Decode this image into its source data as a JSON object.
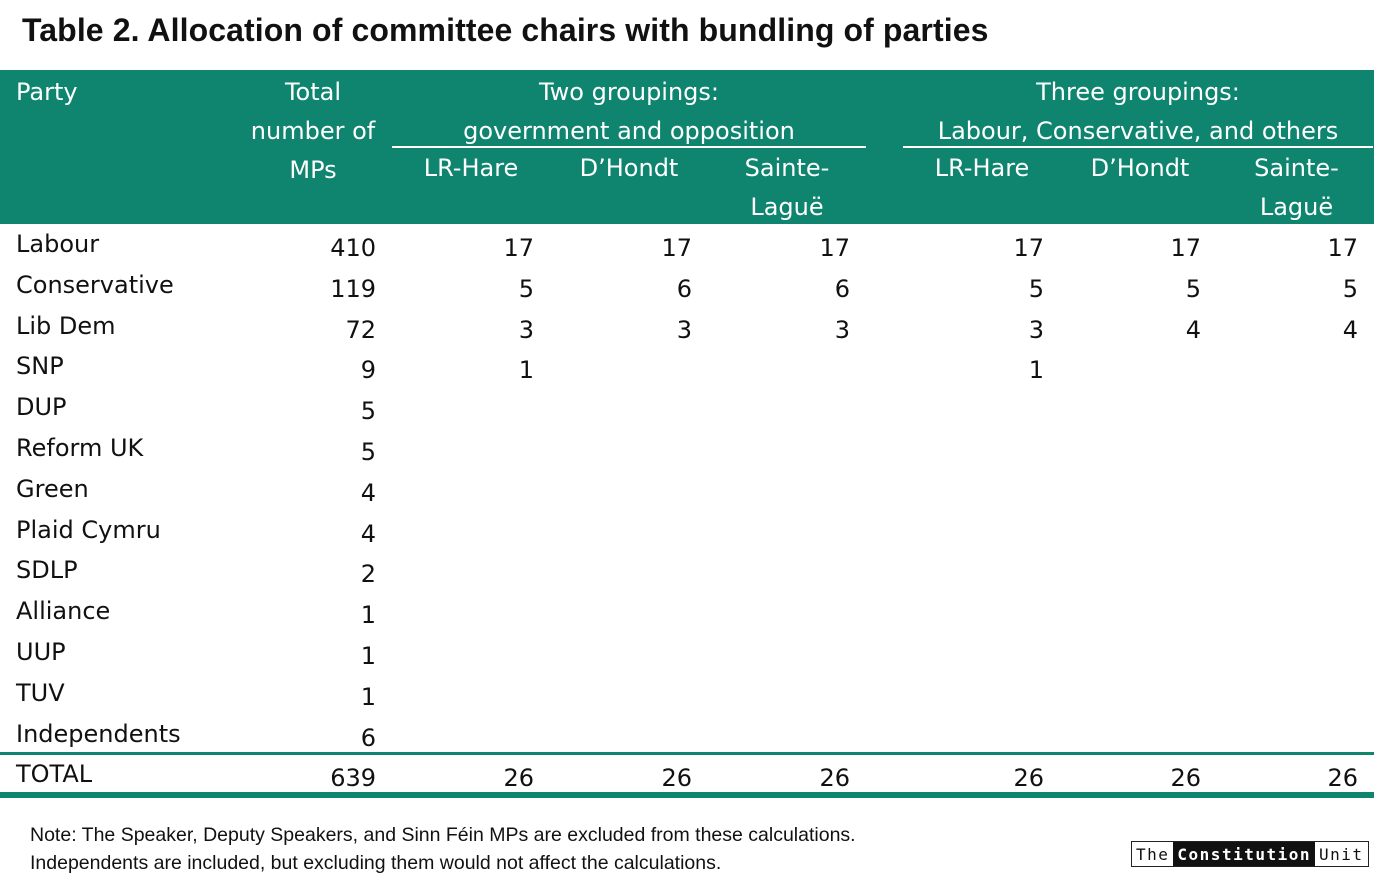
{
  "title": "Table 2. Allocation of committee chairs with bundling of parties",
  "header": {
    "party": "Party",
    "total_line1": "Total",
    "total_line2": "number of",
    "total_line3": "MPs",
    "group2_line1": "Two groupings:",
    "group2_line2": "government and opposition",
    "group3_line1": "Three groupings:",
    "group3_line2": "Labour, Conservative, and others",
    "lr_hare": "LR-Hare",
    "dhondt": "D’Hondt",
    "sl_line1": "Sainte-",
    "sl_line2": "Laguë"
  },
  "rows": [
    {
      "party": "Labour",
      "total": "410",
      "two_lr": "17",
      "two_dh": "17",
      "two_sl": "17",
      "three_lr": "17",
      "three_dh": "17",
      "three_sl": "17"
    },
    {
      "party": "Conservative",
      "total": "119",
      "two_lr": "5",
      "two_dh": "6",
      "two_sl": "6",
      "three_lr": "5",
      "three_dh": "5",
      "three_sl": "5"
    },
    {
      "party": "Lib Dem",
      "total": "72",
      "two_lr": "3",
      "two_dh": "3",
      "two_sl": "3",
      "three_lr": "3",
      "three_dh": "4",
      "three_sl": "4"
    },
    {
      "party": "SNP",
      "total": "9",
      "two_lr": "1",
      "two_dh": "",
      "two_sl": "",
      "three_lr": "1",
      "three_dh": "",
      "three_sl": ""
    },
    {
      "party": "DUP",
      "total": "5",
      "two_lr": "",
      "two_dh": "",
      "two_sl": "",
      "three_lr": "",
      "three_dh": "",
      "three_sl": ""
    },
    {
      "party": "Reform UK",
      "total": "5",
      "two_lr": "",
      "two_dh": "",
      "two_sl": "",
      "three_lr": "",
      "three_dh": "",
      "three_sl": ""
    },
    {
      "party": "Green",
      "total": "4",
      "two_lr": "",
      "two_dh": "",
      "two_sl": "",
      "three_lr": "",
      "three_dh": "",
      "three_sl": ""
    },
    {
      "party": "Plaid Cymru",
      "total": "4",
      "two_lr": "",
      "two_dh": "",
      "two_sl": "",
      "three_lr": "",
      "three_dh": "",
      "three_sl": ""
    },
    {
      "party": "SDLP",
      "total": "2",
      "two_lr": "",
      "two_dh": "",
      "two_sl": "",
      "three_lr": "",
      "three_dh": "",
      "three_sl": ""
    },
    {
      "party": "Alliance",
      "total": "1",
      "two_lr": "",
      "two_dh": "",
      "two_sl": "",
      "three_lr": "",
      "three_dh": "",
      "three_sl": ""
    },
    {
      "party": "UUP",
      "total": "1",
      "two_lr": "",
      "two_dh": "",
      "two_sl": "",
      "three_lr": "",
      "three_dh": "",
      "three_sl": ""
    },
    {
      "party": "TUV",
      "total": "1",
      "two_lr": "",
      "two_dh": "",
      "two_sl": "",
      "three_lr": "",
      "three_dh": "",
      "three_sl": ""
    },
    {
      "party": "Independents",
      "total": "6",
      "two_lr": "",
      "two_dh": "",
      "two_sl": "",
      "three_lr": "",
      "three_dh": "",
      "three_sl": ""
    }
  ],
  "total_row": {
    "party": "TOTAL",
    "total": "639",
    "two_lr": "26",
    "two_dh": "26",
    "two_sl": "26",
    "three_lr": "26",
    "three_dh": "26",
    "three_sl": "26"
  },
  "note_line1": "Note: The Speaker, Deputy Speakers, and Sinn Féin MPs are excluded from these calculations.",
  "note_line2": "Independents are included, but excluding them would not affect the calculations.",
  "logo": {
    "the": "The",
    "constitution": "Constitution",
    "unit": "Unit"
  },
  "colors": {
    "header_bg": "#0f8570",
    "header_text": "#ffffff",
    "body_text": "#111111"
  }
}
